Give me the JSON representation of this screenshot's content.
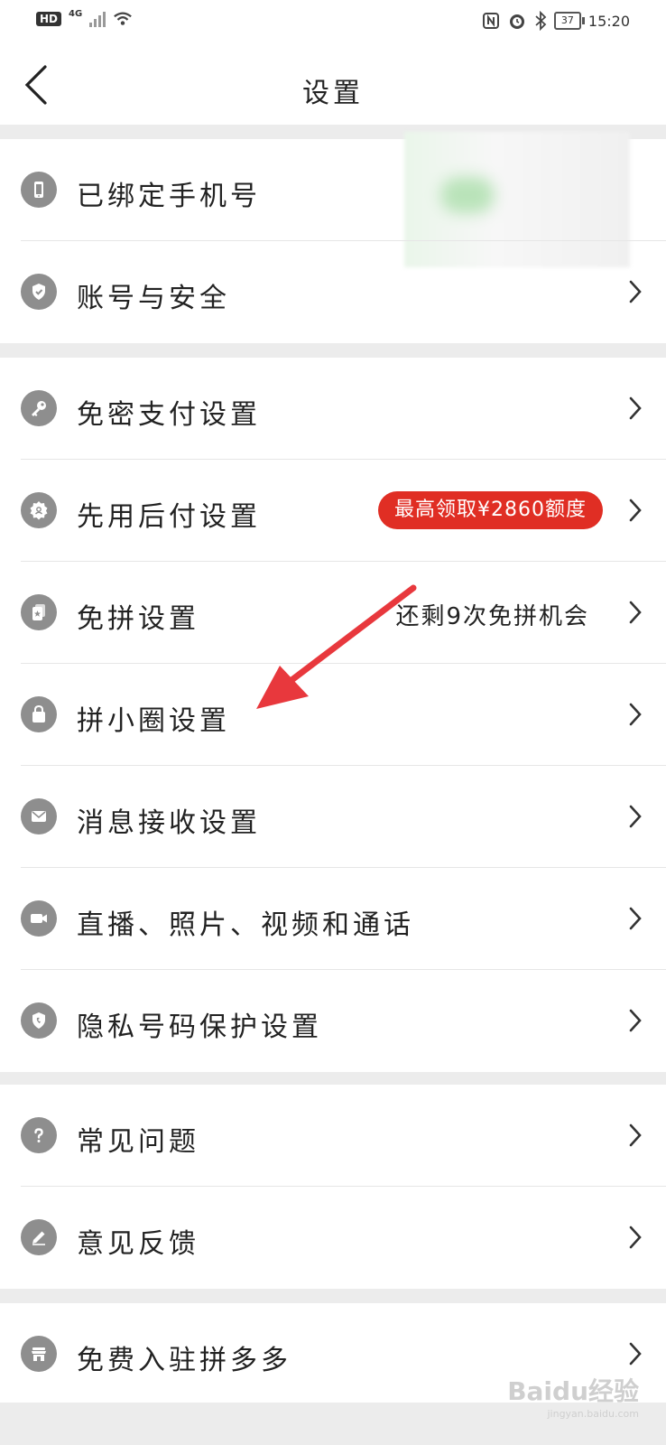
{
  "status_bar": {
    "hd": "HD",
    "network": "4G",
    "battery": "37",
    "time": "15:20"
  },
  "header": {
    "title": "设置"
  },
  "sections": [
    {
      "rows": [
        {
          "label": "已绑定手机号",
          "icon": "phone-icon"
        },
        {
          "label": "账号与安全",
          "icon": "shield-check-icon"
        }
      ]
    },
    {
      "rows": [
        {
          "label": "免密支付设置",
          "icon": "key-icon"
        },
        {
          "label": "先用后付设置",
          "icon": "badge-icon",
          "promo": "最高领取¥2860额度"
        },
        {
          "label": "免拼设置",
          "icon": "card-star-icon",
          "value": "还剩9次免拼机会"
        },
        {
          "label": "拼小圈设置",
          "icon": "bag-icon"
        },
        {
          "label": "消息接收设置",
          "icon": "mail-icon"
        },
        {
          "label": "直播、照片、视频和通话",
          "icon": "video-icon"
        },
        {
          "label": "隐私号码保护设置",
          "icon": "privacy-shield-icon"
        }
      ]
    },
    {
      "rows": [
        {
          "label": "常见问题",
          "icon": "question-icon"
        },
        {
          "label": "意见反馈",
          "icon": "pencil-icon"
        }
      ]
    },
    {
      "rows": [
        {
          "label": "免费入驻拼多多",
          "icon": "store-icon"
        }
      ]
    }
  ],
  "colors": {
    "accent": "#e02e24",
    "icon_bg": "#8e8e8e",
    "page_bg": "#ececec",
    "annotation_arrow": "#e8383d"
  },
  "watermark": {
    "brand": "Baidu经验",
    "url": "jingyan.baidu.com"
  }
}
